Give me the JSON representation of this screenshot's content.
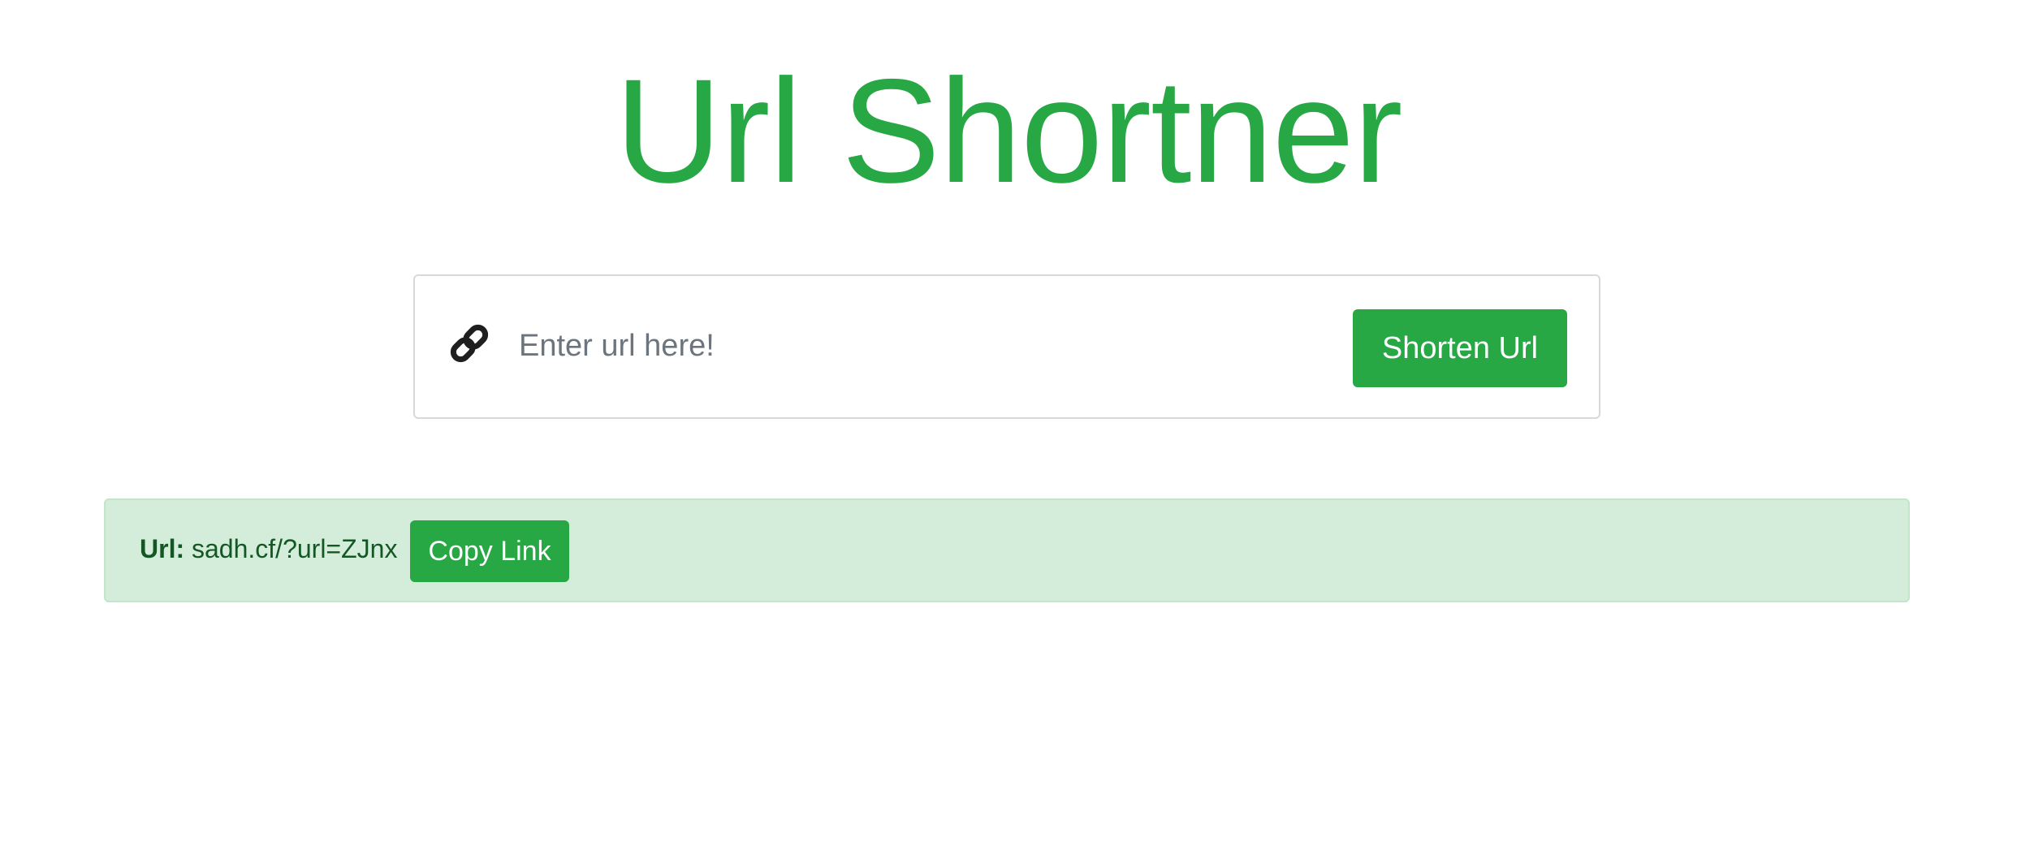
{
  "header": {
    "title": "Url Shortner"
  },
  "form": {
    "icon": "link-icon",
    "input_placeholder": "Enter url here!",
    "input_value": "",
    "submit_label": "Shorten Url"
  },
  "result": {
    "label": "Url:",
    "short_url": "sadh.cf/?url=ZJnx",
    "copy_label": "Copy Link"
  },
  "colors": {
    "accent": "#28a745",
    "alert_background": "#d4edda",
    "alert_text": "#155724"
  }
}
